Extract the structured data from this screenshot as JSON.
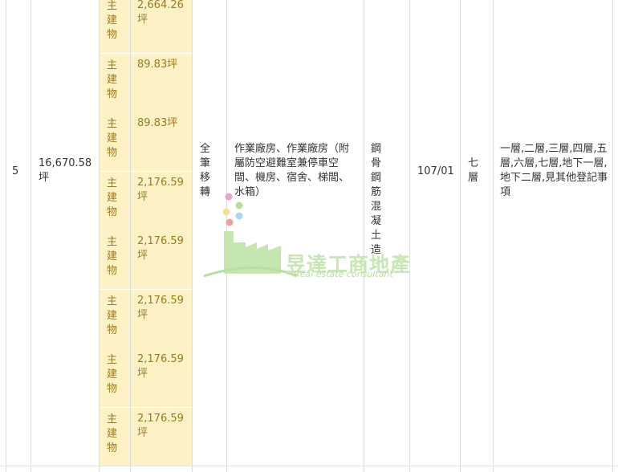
{
  "row": {
    "index": "5",
    "total_area": "16,670.58坪",
    "rights": "全筆移轉",
    "usage": "作業廠房、作業廠房（附屬防空避難室兼停車空間、機房、宿舍、梯間、水箱）",
    "structure": "鋼骨鋼筋混凝土造",
    "completion_date": "107/01",
    "floors_total": "七層",
    "floor_notes": "一層,二層,三層,四層,五層,六層,七層,地下一層,地下二層,見其他登記事項"
  },
  "sub_rows": [
    {
      "label": "主建物",
      "area": "2,664.26坪"
    },
    {
      "label": "主建物",
      "area": "89.83坪"
    },
    {
      "label": "主建物",
      "area": "89.83坪"
    },
    {
      "label": "主建物",
      "area": "2,176.59坪"
    },
    {
      "label": "主建物",
      "area": "2,176.59坪"
    },
    {
      "label": "主建物",
      "area": "2,176.59坪"
    },
    {
      "label": "主建物",
      "area": "2,176.59坪"
    },
    {
      "label": "主建物",
      "area": "2,176.59坪"
    }
  ],
  "watermark": {
    "name": "昱達工商地產",
    "tagline": "Real estate consultant",
    "icon": "factory-logo-icon",
    "colors": {
      "green": "#b9dea3",
      "pink": "#e7a6cf",
      "yellow": "#f7dca0",
      "blue": "#a9d8ef"
    }
  },
  "colors": {
    "sub_bg": "#fdf2c6",
    "sub_text": "#9a7a1f",
    "grid": "#dcdcdc"
  }
}
